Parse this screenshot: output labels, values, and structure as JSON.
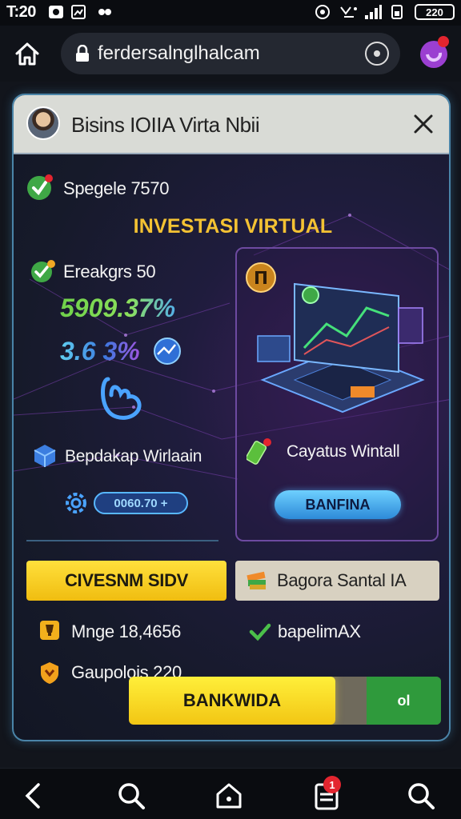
{
  "status_bar": {
    "time": "T:20",
    "battery": "220"
  },
  "browser": {
    "url": "ferdersalnglhalcam"
  },
  "card": {
    "title": "Bisins IOIIA Virta Nbii",
    "row1_label": "Spegele 7570",
    "heading": "INVESTASI VIRTUAL",
    "row2_label": "Ereakgrs 50",
    "big_green_value": "5909.37%",
    "big_blue_value": "3.6 3%",
    "row3_label": "Bepdakap Wirlaain",
    "pill_value": "0060.70 +",
    "right_label": "Cayatus Wintall",
    "blue_button": "BANFINA",
    "yellow_button": "CIVESNM SIDV",
    "grey_button": "Bagora Santal IA",
    "stat1": "Mnge 18,4656",
    "stat2": "bapelimAX",
    "stat3": "Gaupolois 220",
    "footer_yellow": "BANKWIDA",
    "footer_green": "ol"
  },
  "colors": {
    "accent_yellow": "#f4c233",
    "accent_blue": "#58b7ff",
    "accent_green": "#2f9a3c",
    "notification_red": "#e3252f"
  },
  "bottom_nav": {
    "badge_count": "1"
  }
}
